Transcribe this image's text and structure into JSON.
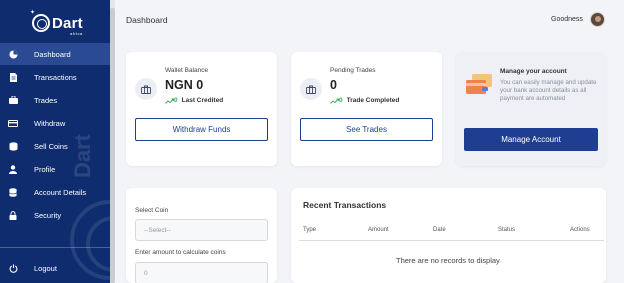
{
  "app": {
    "logo_name": "Dart",
    "logo_sub": "africa"
  },
  "sidebar": {
    "items": [
      {
        "label": "Dashboard",
        "icon": "dashboard-icon",
        "active": true
      },
      {
        "label": "Transactions",
        "icon": "document-icon"
      },
      {
        "label": "Trades",
        "icon": "briefcase-icon"
      },
      {
        "label": "Withdraw",
        "icon": "card-icon"
      },
      {
        "label": "Sell Coins",
        "icon": "coins-icon"
      },
      {
        "label": "Profile",
        "icon": "user-icon"
      },
      {
        "label": "Account Details",
        "icon": "database-icon"
      },
      {
        "label": "Security",
        "icon": "lock-icon"
      }
    ],
    "logout_label": "Logout",
    "watermark_text": "Dart"
  },
  "header": {
    "title": "Dashboard",
    "user_name": "Goodness"
  },
  "wallet": {
    "title": "Wallet Balance",
    "value": "NGN 0",
    "trend_pct": "0",
    "trend_label": "Last Credited",
    "button": "Withdraw Funds"
  },
  "pending": {
    "title": "Pending Trades",
    "value": "0",
    "trend_pct": "0",
    "trend_label": "Trade Completed",
    "button": "See Trades"
  },
  "manage": {
    "title": "Manage your account",
    "description": "You can easily manage and update your bank account details as all payment are automated",
    "button": "Manage Account"
  },
  "calculator": {
    "coin_label": "Select Coin",
    "coin_placeholder": "--Select--",
    "amount_label": "Enter amount to calculate coins",
    "amount_value": "0"
  },
  "transactions": {
    "title": "Recent Transactions",
    "columns": [
      "Type",
      "Amount",
      "Date",
      "Status",
      "Actions"
    ],
    "empty_message": "There are no records to display"
  },
  "colors": {
    "sidebar": "#0f2c6e",
    "sidebar_active": "#2a4a93",
    "primary": "#1e3f91",
    "trend_green": "#3aa85a"
  }
}
